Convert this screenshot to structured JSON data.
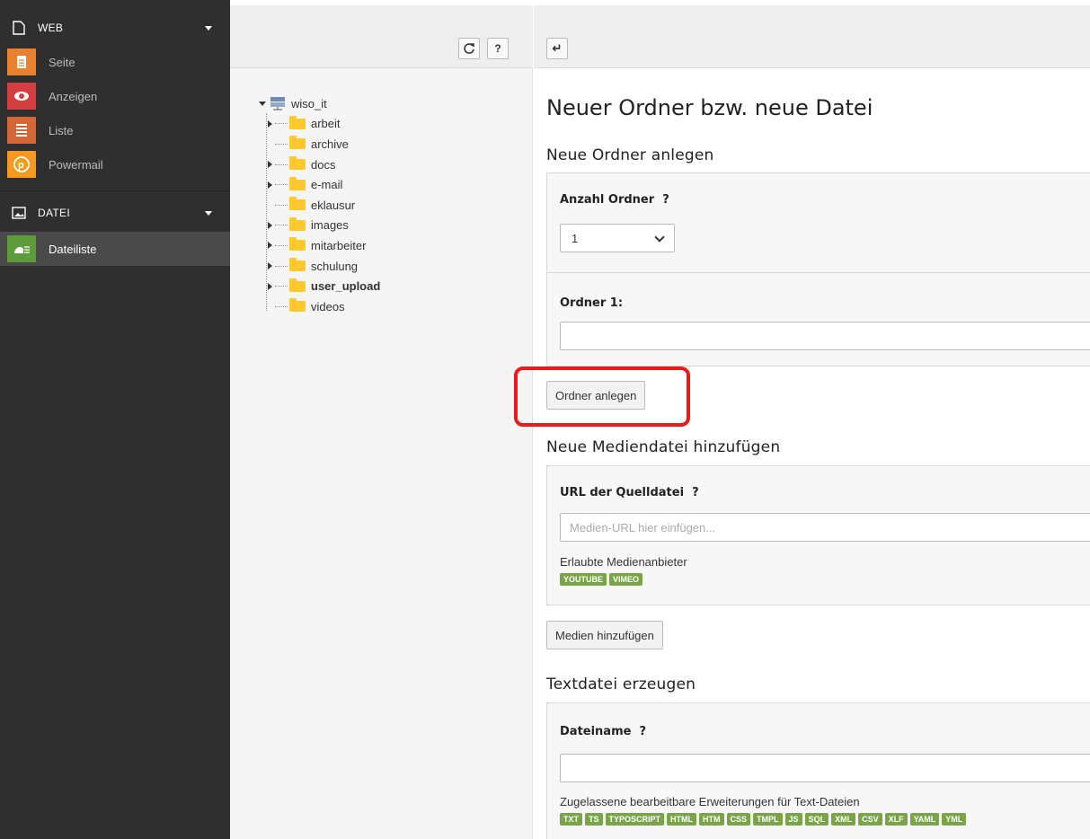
{
  "modmenu": {
    "groups": [
      {
        "label": "WEB",
        "icon": "page-icon"
      },
      {
        "label": "DATEI",
        "icon": "image-icon"
      }
    ],
    "web_items": [
      {
        "label": "Seite",
        "icon": "page-module-icon",
        "color": "#e8812f"
      },
      {
        "label": "Anzeigen",
        "icon": "eye-icon",
        "color": "#d44040"
      },
      {
        "label": "Liste",
        "icon": "list-icon",
        "color": "#d46737"
      },
      {
        "label": "Powermail",
        "icon": "powermail-icon",
        "color": "#f39a1f"
      }
    ],
    "datei_items": [
      {
        "label": "Dateiliste",
        "icon": "filelist-icon",
        "color": "#5d9b3b"
      }
    ]
  },
  "tree": {
    "buttons": {
      "refresh": "refresh-icon",
      "help": "?"
    },
    "root": "wiso_it",
    "nodes": [
      {
        "label": "arbeit",
        "expandable": true,
        "bold": false
      },
      {
        "label": "archive",
        "expandable": false,
        "bold": false
      },
      {
        "label": "docs",
        "expandable": true,
        "bold": false
      },
      {
        "label": "e-mail",
        "expandable": true,
        "bold": false
      },
      {
        "label": "eklausur",
        "expandable": false,
        "bold": false
      },
      {
        "label": "images",
        "expandable": true,
        "bold": false
      },
      {
        "label": "mitarbeiter",
        "expandable": true,
        "bold": false
      },
      {
        "label": "schulung",
        "expandable": true,
        "bold": false
      },
      {
        "label": "user_upload",
        "expandable": true,
        "bold": true
      },
      {
        "label": "videos",
        "expandable": false,
        "bold": false
      }
    ]
  },
  "content": {
    "back_button": "↵",
    "title": "Neuer Ordner bzw. neue Datei",
    "folders": {
      "heading": "Neue Ordner anlegen",
      "count_label": "Anzahl Ordner",
      "count_value": "1",
      "folder1_label": "Ordner 1:",
      "folder1_value": "",
      "submit": "Ordner anlegen"
    },
    "media": {
      "heading": "Neue Mediendatei hinzufügen",
      "url_label": "URL der Quelldatei",
      "url_placeholder": "Medien-URL hier einfügen...",
      "providers_label": "Erlaubte Medienanbieter",
      "providers": [
        "YOUTUBE",
        "VIMEO"
      ],
      "submit": "Medien hinzufügen"
    },
    "textfile": {
      "heading": "Textdatei erzeugen",
      "name_label": "Dateiname",
      "name_value": "",
      "extensions_label": "Zugelassene bearbeitbare Erweiterungen für Text-Dateien",
      "extensions": [
        "TXT",
        "TS",
        "TYPOSCRIPT",
        "HTML",
        "HTM",
        "CSS",
        "TMPL",
        "JS",
        "SQL",
        "XML",
        "CSV",
        "XLF",
        "YAML",
        "YML"
      ]
    },
    "help_mark": "?"
  },
  "colors": {
    "highlight": "#e81c1c",
    "badge": "#79a548",
    "folder": "#ffc82c"
  }
}
